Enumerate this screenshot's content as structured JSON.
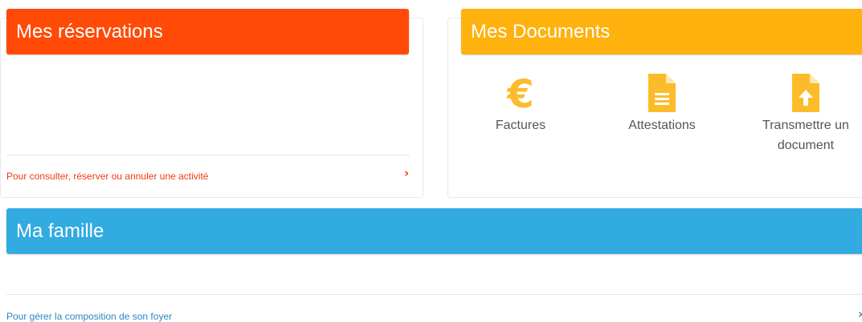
{
  "reservations": {
    "title": "Mes réservations",
    "link": "Pour consulter, réserver ou annuler une activité",
    "chevron": "›"
  },
  "documents": {
    "title": "Mes Documents",
    "items": [
      {
        "label": "Factures",
        "icon": "euro-icon"
      },
      {
        "label": "Attestations",
        "icon": "document-icon"
      },
      {
        "label_line1": "Transmettre un",
        "label_line2": "document",
        "icon": "upload-document-icon"
      }
    ]
  },
  "famille": {
    "title": "Ma famille",
    "link": "Pour gérer la composition de son foyer",
    "chevron": "›"
  },
  "colors": {
    "reservations": "#ff4a08",
    "documents": "#ffb10d",
    "famille": "#31abe0",
    "link_red": "#f2390c",
    "link_blue": "#2b86c5",
    "icon_yellow": "#fcbc2a"
  }
}
